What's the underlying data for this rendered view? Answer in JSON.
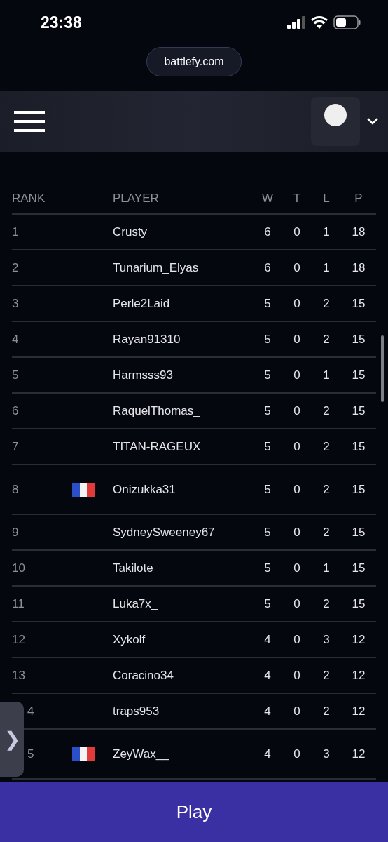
{
  "status_bar": {
    "time": "23:38"
  },
  "address_bar": {
    "url": "battlefy.com"
  },
  "table": {
    "columns": [
      "RANK",
      "PLAYER",
      "W",
      "T",
      "L",
      "P"
    ],
    "rows": [
      {
        "rank": "1",
        "player": "Crusty",
        "w": "6",
        "t": "0",
        "l": "1",
        "p": "18"
      },
      {
        "rank": "2",
        "player": "Tunarium_Elyas",
        "w": "6",
        "t": "0",
        "l": "1",
        "p": "18"
      },
      {
        "rank": "3",
        "player": "Perle2Laid",
        "w": "5",
        "t": "0",
        "l": "2",
        "p": "15"
      },
      {
        "rank": "4",
        "player": "Rayan91310",
        "w": "5",
        "t": "0",
        "l": "2",
        "p": "15"
      },
      {
        "rank": "5",
        "player": "Harmsss93",
        "w": "5",
        "t": "0",
        "l": "1",
        "p": "15"
      },
      {
        "rank": "6",
        "player": "RaquelThomas_",
        "w": "5",
        "t": "0",
        "l": "2",
        "p": "15"
      },
      {
        "rank": "7",
        "player": "TITAN-RAGEUX",
        "w": "5",
        "t": "0",
        "l": "2",
        "p": "15"
      },
      {
        "rank": "8",
        "flag": true,
        "player": "Onizukka31",
        "w": "5",
        "t": "0",
        "l": "2",
        "p": "15"
      },
      {
        "rank": "9",
        "player": "SydneySweeney67",
        "w": "5",
        "t": "0",
        "l": "2",
        "p": "15"
      },
      {
        "rank": "10",
        "player": "Takilote",
        "w": "5",
        "t": "0",
        "l": "1",
        "p": "15"
      },
      {
        "rank": "11",
        "player": "Luka7x_",
        "w": "5",
        "t": "0",
        "l": "2",
        "p": "15"
      },
      {
        "rank": "12",
        "player": "Xykolf",
        "w": "4",
        "t": "0",
        "l": "3",
        "p": "12"
      },
      {
        "rank": "13",
        "player": "Coracino34",
        "w": "4",
        "t": "0",
        "l": "2",
        "p": "12"
      },
      {
        "rank": "4",
        "clipped": true,
        "player": "traps953",
        "w": "4",
        "t": "0",
        "l": "2",
        "p": "12"
      },
      {
        "rank": "5",
        "clipped": true,
        "flag": true,
        "player": "ZeyWax__",
        "w": "4",
        "t": "0",
        "l": "3",
        "p": "12"
      }
    ]
  },
  "side_tab": {
    "icon": "❯"
  },
  "play_button": {
    "label": "Play"
  }
}
